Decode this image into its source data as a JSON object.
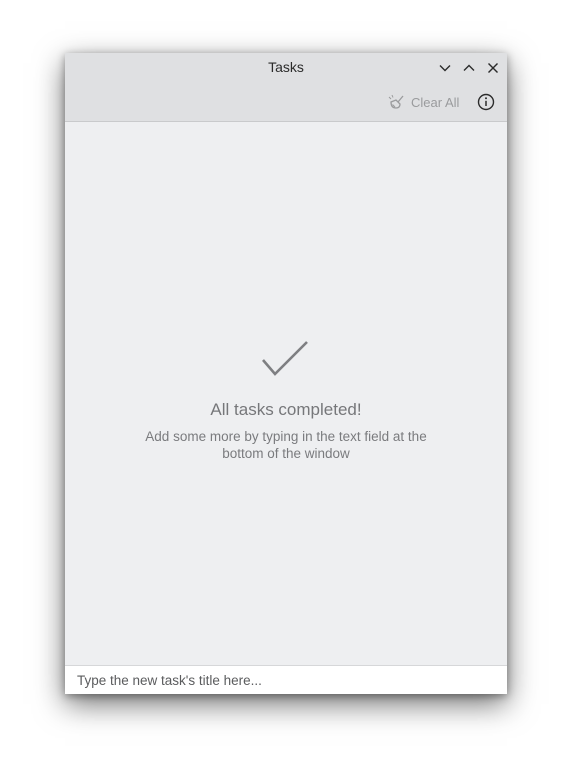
{
  "window": {
    "title": "Tasks"
  },
  "titlebar": {
    "minimize_icon": "chevron-down-icon",
    "maximize_icon": "chevron-up-icon",
    "close_icon": "close-icon"
  },
  "toolbar": {
    "clear_all_label": "Clear All",
    "clear_all_icon": "broom-icon",
    "info_icon": "info-icon"
  },
  "empty_state": {
    "icon": "checkmark-icon",
    "title": "All tasks completed!",
    "subtitle": "Add some more by typing in the text field at the bottom of the window"
  },
  "new_task": {
    "placeholder": "Type the new task's title here...",
    "value": ""
  },
  "colors": {
    "header_bg": "#dfe0e2",
    "content_bg": "#eeeff1",
    "muted_text": "#76777a"
  }
}
